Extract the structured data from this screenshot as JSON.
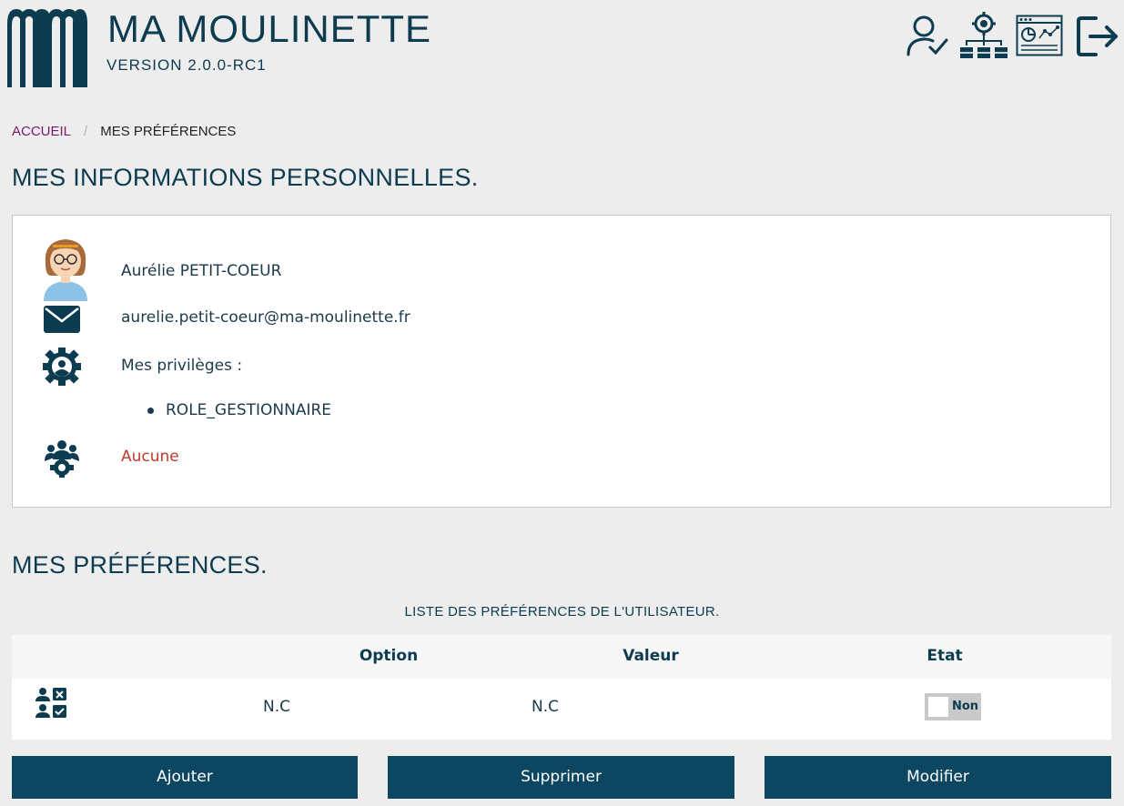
{
  "header": {
    "app_title": "MA MOULINETTE",
    "version": "VERSION 2.0.0-RC1",
    "icons": [
      "user-check-icon",
      "org-settings-icon",
      "dashboard-icon",
      "logout-icon"
    ]
  },
  "breadcrumb": {
    "home": "ACCUEIL",
    "separator": "/",
    "current": "MES PRÉFÉRENCES"
  },
  "personal": {
    "title": "MES INFORMATIONS PERSONNELLES.",
    "name": "Aurélie PETIT-COEUR",
    "email": "aurelie.petit-coeur@ma-moulinette.fr",
    "privileges_label": "Mes privilèges :",
    "privileges": [
      "ROLE_GESTIONNAIRE"
    ],
    "teams": "Aucune"
  },
  "preferences": {
    "title": "MES PRÉFÉRENCES.",
    "caption": "LISTE DES PRÉFÉRENCES DE L'UTILISATEUR.",
    "columns": [
      "",
      "Option",
      "Valeur",
      "Etat"
    ],
    "rows": [
      {
        "option": "N.C",
        "value": "N.C",
        "state": "Non"
      }
    ]
  },
  "buttons": {
    "add": "Ajouter",
    "delete": "Supprimer",
    "edit": "Modifier"
  },
  "colors": {
    "primary": "#0d3b4f",
    "button_bg": "#0d4660",
    "breadcrumb_link": "#7a1a6a",
    "none_red": "#c0392b",
    "page_bg": "#ededed"
  }
}
